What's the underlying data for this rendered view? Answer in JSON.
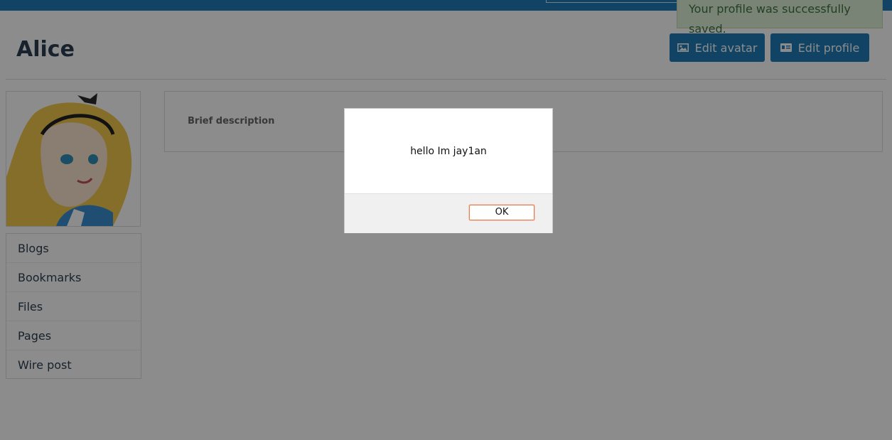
{
  "notice": {
    "text": "Your profile was successfully saved."
  },
  "profile": {
    "name": "Alice"
  },
  "actions": {
    "edit_avatar": "Edit avatar",
    "edit_profile": "Edit profile"
  },
  "sidebar": {
    "items": [
      {
        "label": "Blogs"
      },
      {
        "label": "Bookmarks"
      },
      {
        "label": "Files"
      },
      {
        "label": "Pages"
      },
      {
        "label": "Wire post"
      }
    ]
  },
  "details": {
    "brief_description_label": "Brief description"
  },
  "dialog": {
    "message": "hello Im jay1an",
    "ok_label": "OK"
  },
  "colors": {
    "accent": "#1f7bb6",
    "notice_bg": "#dff0d8",
    "notice_text": "#3c763d"
  }
}
